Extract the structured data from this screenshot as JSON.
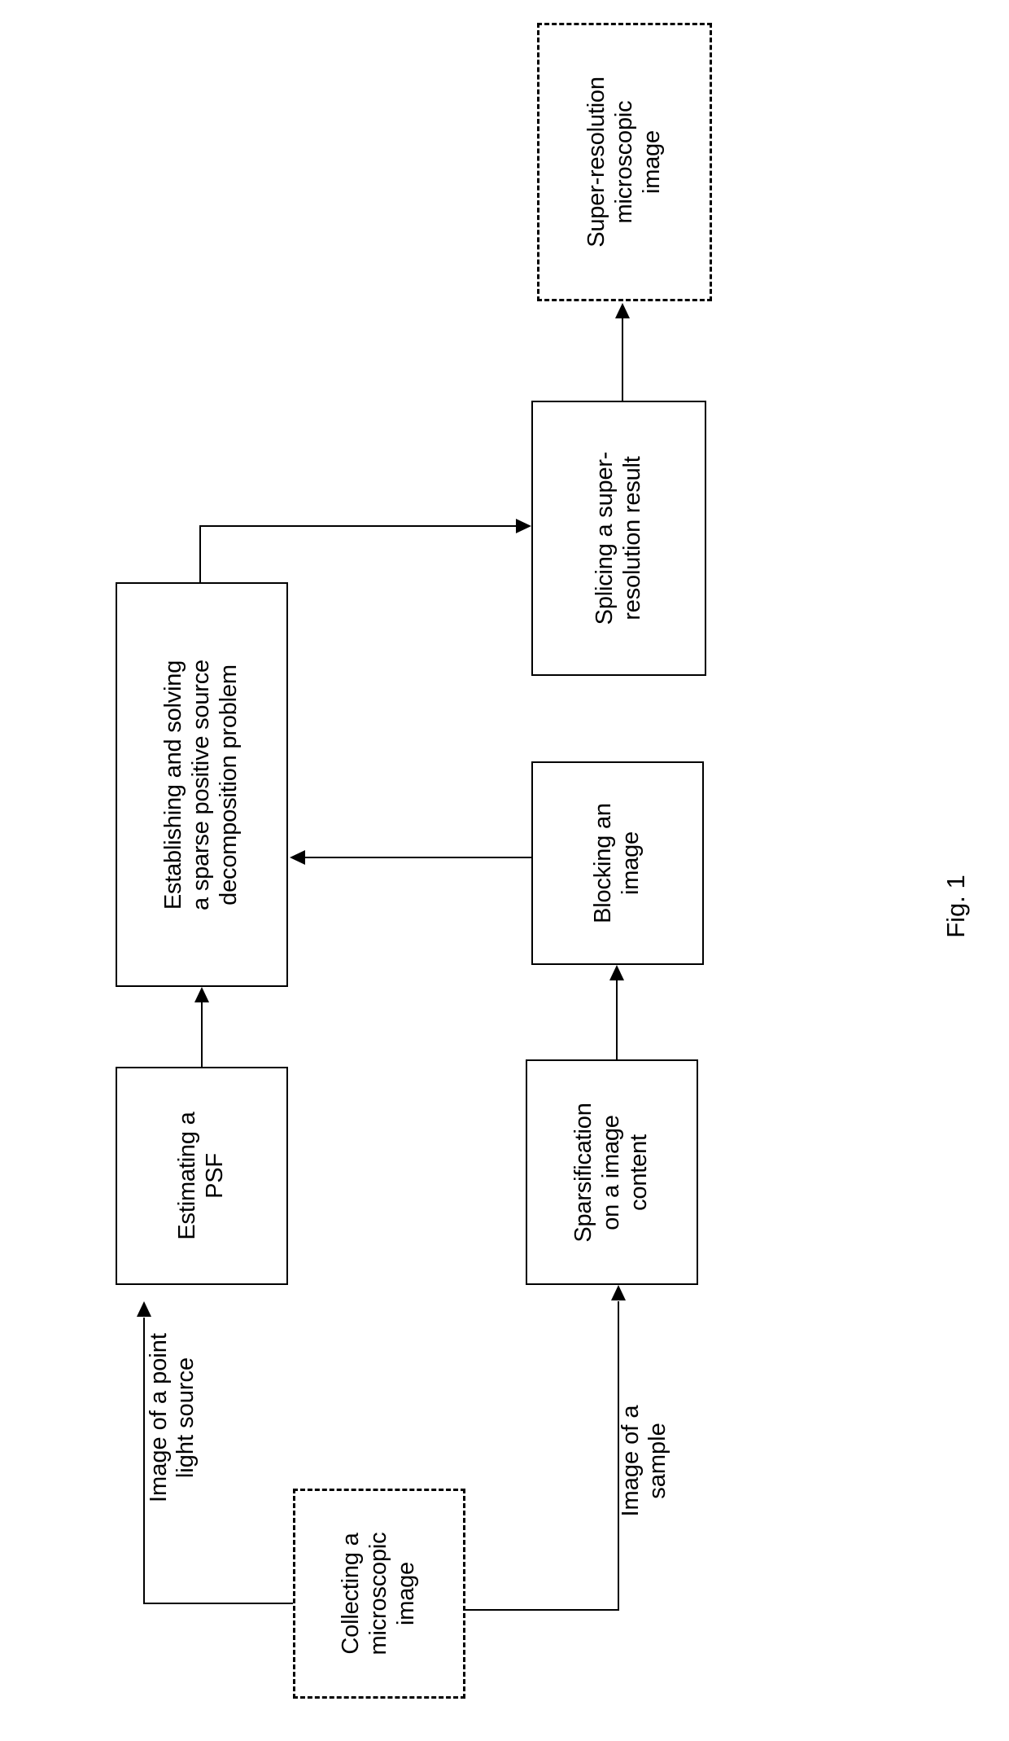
{
  "figure": {
    "caption": "Fig. 1",
    "orientation": "rotated-90-ccw",
    "type": "flowchart"
  },
  "nodes": {
    "output": {
      "label": "Super-resolution\nmicroscopic\nimage",
      "style": "dashed"
    },
    "splicing": {
      "label": "Splicing a super-\nresolution result",
      "style": "solid"
    },
    "establishing": {
      "label": "Establishing and solving\na sparse positive source\ndecomposition problem",
      "style": "solid"
    },
    "blocking": {
      "label": "Blocking an\nimage",
      "style": "solid"
    },
    "estimating": {
      "label": "Estimating a\nPSF",
      "style": "solid"
    },
    "sparsification": {
      "label": "Sparsification\non a image\ncontent",
      "style": "solid"
    },
    "collecting": {
      "label": "Collecting a\nmicroscopic\nimage",
      "style": "dashed"
    }
  },
  "edge_labels": {
    "point_light_source": "Image of a point\nlight source",
    "sample": "Image of a\nsample"
  },
  "colors": {
    "stroke": "#000000",
    "background": "#ffffff",
    "text": "#000000"
  }
}
